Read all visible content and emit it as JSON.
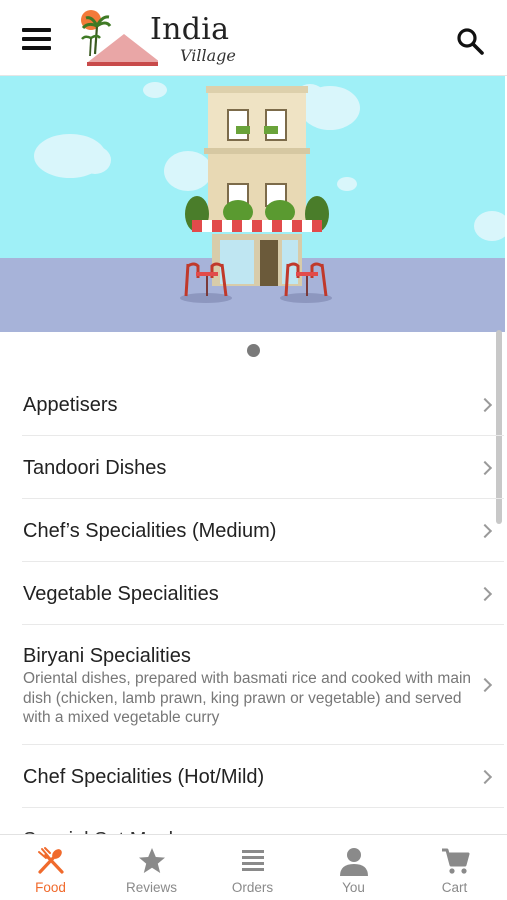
{
  "header": {
    "logo_title": "India",
    "logo_subtitle": "Village",
    "menu_icon": "hamburger-menu-icon",
    "search_icon": "search-icon"
  },
  "banner": {
    "illustration": "restaurant-building-illustration",
    "carousel_pages": 1,
    "carousel_active": 1
  },
  "menu": {
    "items": [
      {
        "label": "Appetisers"
      },
      {
        "label": "Tandoori Dishes"
      },
      {
        "label": "Chef’s Specialities (Medium)"
      },
      {
        "label": "Vegetable Specialities"
      },
      {
        "label": "Biryani Specialities",
        "description": "Oriental dishes, prepared with basmati rice and cooked with main dish (chicken, lamb prawn, king prawn or vegetable) and served with a mixed vegetable curry"
      },
      {
        "label": "Chef Specialities (Hot/Mild)"
      },
      {
        "label": "Special Set Meals"
      }
    ]
  },
  "tabs": [
    {
      "label": "Food",
      "icon": "fork-knife-icon",
      "active": true
    },
    {
      "label": "Reviews",
      "icon": "star-icon",
      "active": false
    },
    {
      "label": "Orders",
      "icon": "list-icon",
      "active": false
    },
    {
      "label": "You",
      "icon": "person-icon",
      "active": false
    },
    {
      "label": "Cart",
      "icon": "cart-icon",
      "active": false
    }
  ],
  "colors": {
    "accent": "#f06a2c",
    "sky": "#9ff0f7",
    "ground": "#a7b3d9",
    "inactive_tab": "#8a8a8a"
  }
}
